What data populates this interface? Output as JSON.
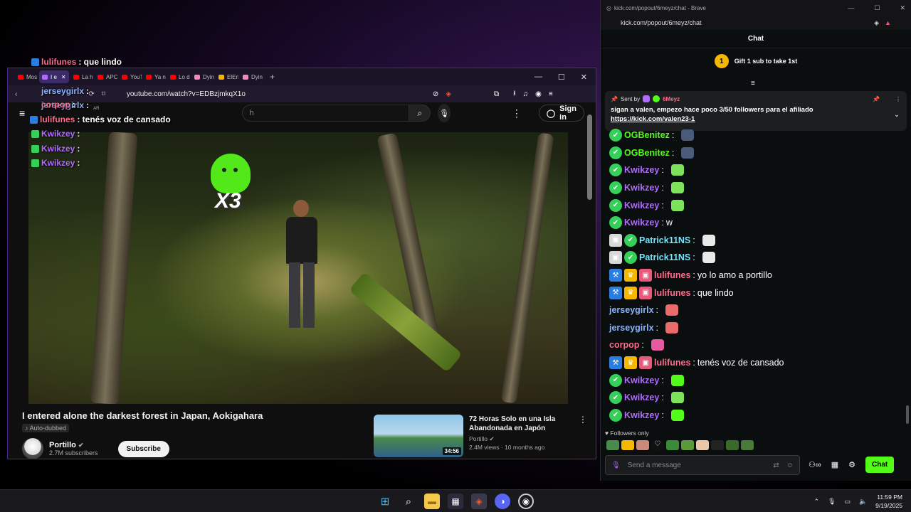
{
  "overlay": {
    "lines": [
      {
        "user": "lulifunes",
        "text": ": que lindo",
        "color": "#ff6b8a"
      },
      {
        "user": "jerseygirlx",
        "text": " :",
        "color": "#8ab4ff"
      },
      {
        "user": "jerseygirlx",
        "text": " :",
        "color": "#8ab4ff"
      },
      {
        "user": "corpop",
        "text": " :",
        "color": "#ff6b8a"
      },
      {
        "user": "lulifunes",
        "text": ": tenés voz de cansado",
        "color": "#ff6b8a"
      },
      {
        "user": "Kwikzey",
        "text": " :",
        "color": "#b16bff"
      },
      {
        "user": "Kwikzey",
        "text": " :",
        "color": "#b16bff"
      },
      {
        "user": "Kwikzey",
        "text": " :",
        "color": "#b16bff"
      }
    ],
    "emote_x3": "X3"
  },
  "youtube_window": {
    "tabs": [
      "Mos",
      "I e",
      "La h",
      "APC",
      "YouT",
      "Ya n",
      "Lo d",
      "Dyin",
      "ElEn",
      "Dyin"
    ],
    "url": "youtube.com/watch?v=EDBzjmkqX1o",
    "search_placeholder": "h",
    "region": "AR",
    "signin_label": "Sign in",
    "video": {
      "title": "I entered alone the darkest forest in Japan, Aokigahara",
      "auto_dubbed": "Auto-dubbed",
      "channel": "Portillo",
      "subscribers": "2.7M subscribers",
      "subscribe_label": "Subscribe"
    },
    "recommended": {
      "title": "72 Horas Solo en una Isla Abandonada en Japón",
      "channel": "Portillo",
      "meta": "2.4M views · 10 months ago",
      "duration": "34:56"
    }
  },
  "chat_window": {
    "window_title": "kick.com/popout/6meyz/chat - Brave",
    "url": "kick.com/popout/6meyz/chat",
    "header": "Chat",
    "gift": {
      "count": "1",
      "text": "Gift 1 sub to take 1st"
    },
    "pinned": {
      "sent_by": "Sent by",
      "sender": "6Meyz",
      "message": "sigan a valen, empezo hace poco 3/50 followers para el afiliado",
      "link": "https://kick.com/valen23-1"
    },
    "messages": [
      {
        "user": "OGBenitez",
        "color": "#53fc18",
        "text": "",
        "badges": [
          "verified"
        ],
        "emote": "#4a5a7a"
      },
      {
        "user": "OGBenitez",
        "color": "#53fc18",
        "text": "",
        "badges": [
          "verified"
        ],
        "emote": "#4a5a7a"
      },
      {
        "user": "Kwikzey",
        "color": "#b16bff",
        "text": "",
        "badges": [
          "verified"
        ],
        "emote": "#7ce35a"
      },
      {
        "user": "Kwikzey",
        "color": "#b16bff",
        "text": "",
        "badges": [
          "verified"
        ],
        "emote": "#7ce35a"
      },
      {
        "user": "Kwikzey",
        "color": "#b16bff",
        "text": "",
        "badges": [
          "verified"
        ],
        "emote": "#7ce35a"
      },
      {
        "user": "Kwikzey",
        "color": "#b16bff",
        "text": "w",
        "badges": [
          "verified"
        ],
        "emote": ""
      },
      {
        "user": "Patrick11NS",
        "color": "#6ee7ff",
        "text": "",
        "badges": [
          "gray",
          "verified"
        ],
        "emote": "#e8e8e8"
      },
      {
        "user": "Patrick11NS",
        "color": "#6ee7ff",
        "text": "",
        "badges": [
          "gray",
          "verified"
        ],
        "emote": "#e8e8e8"
      },
      {
        "user": "lulifunes",
        "color": "#ff6b8a",
        "text": "yo lo amo a portillo",
        "badges": [
          "mod",
          "crown",
          "sub"
        ],
        "emote": ""
      },
      {
        "user": "lulifunes",
        "color": "#ff6b8a",
        "text": "que lindo",
        "badges": [
          "mod",
          "crown",
          "sub"
        ],
        "emote": ""
      },
      {
        "user": "jerseygirlx",
        "color": "#8ab4ff",
        "text": "",
        "badges": [],
        "emote": "#e86a6a"
      },
      {
        "user": "jerseygirlx",
        "color": "#8ab4ff",
        "text": "",
        "badges": [],
        "emote": "#e86a6a"
      },
      {
        "user": "corpop",
        "color": "#ff6b8a",
        "text": "",
        "badges": [],
        "emote": "#e85aa0"
      },
      {
        "user": "lulifunes",
        "color": "#ff6b8a",
        "text": "tenés voz de cansado",
        "badges": [
          "mod",
          "crown",
          "sub"
        ],
        "emote": ""
      },
      {
        "user": "Kwikzey",
        "color": "#b16bff",
        "text": "",
        "badges": [
          "verified"
        ],
        "emote": "#53fc18"
      },
      {
        "user": "Kwikzey",
        "color": "#b16bff",
        "text": "",
        "badges": [
          "verified"
        ],
        "emote": "#7ce35a"
      },
      {
        "user": "Kwikzey",
        "color": "#b16bff",
        "text": "",
        "badges": [
          "verified"
        ],
        "emote": "#53fc18"
      }
    ],
    "followers_only": "Followers only",
    "input_placeholder": "Send a message",
    "chat_button": "Chat"
  },
  "taskbar": {
    "time": "11:59 PM",
    "date": "9/19/2025"
  }
}
